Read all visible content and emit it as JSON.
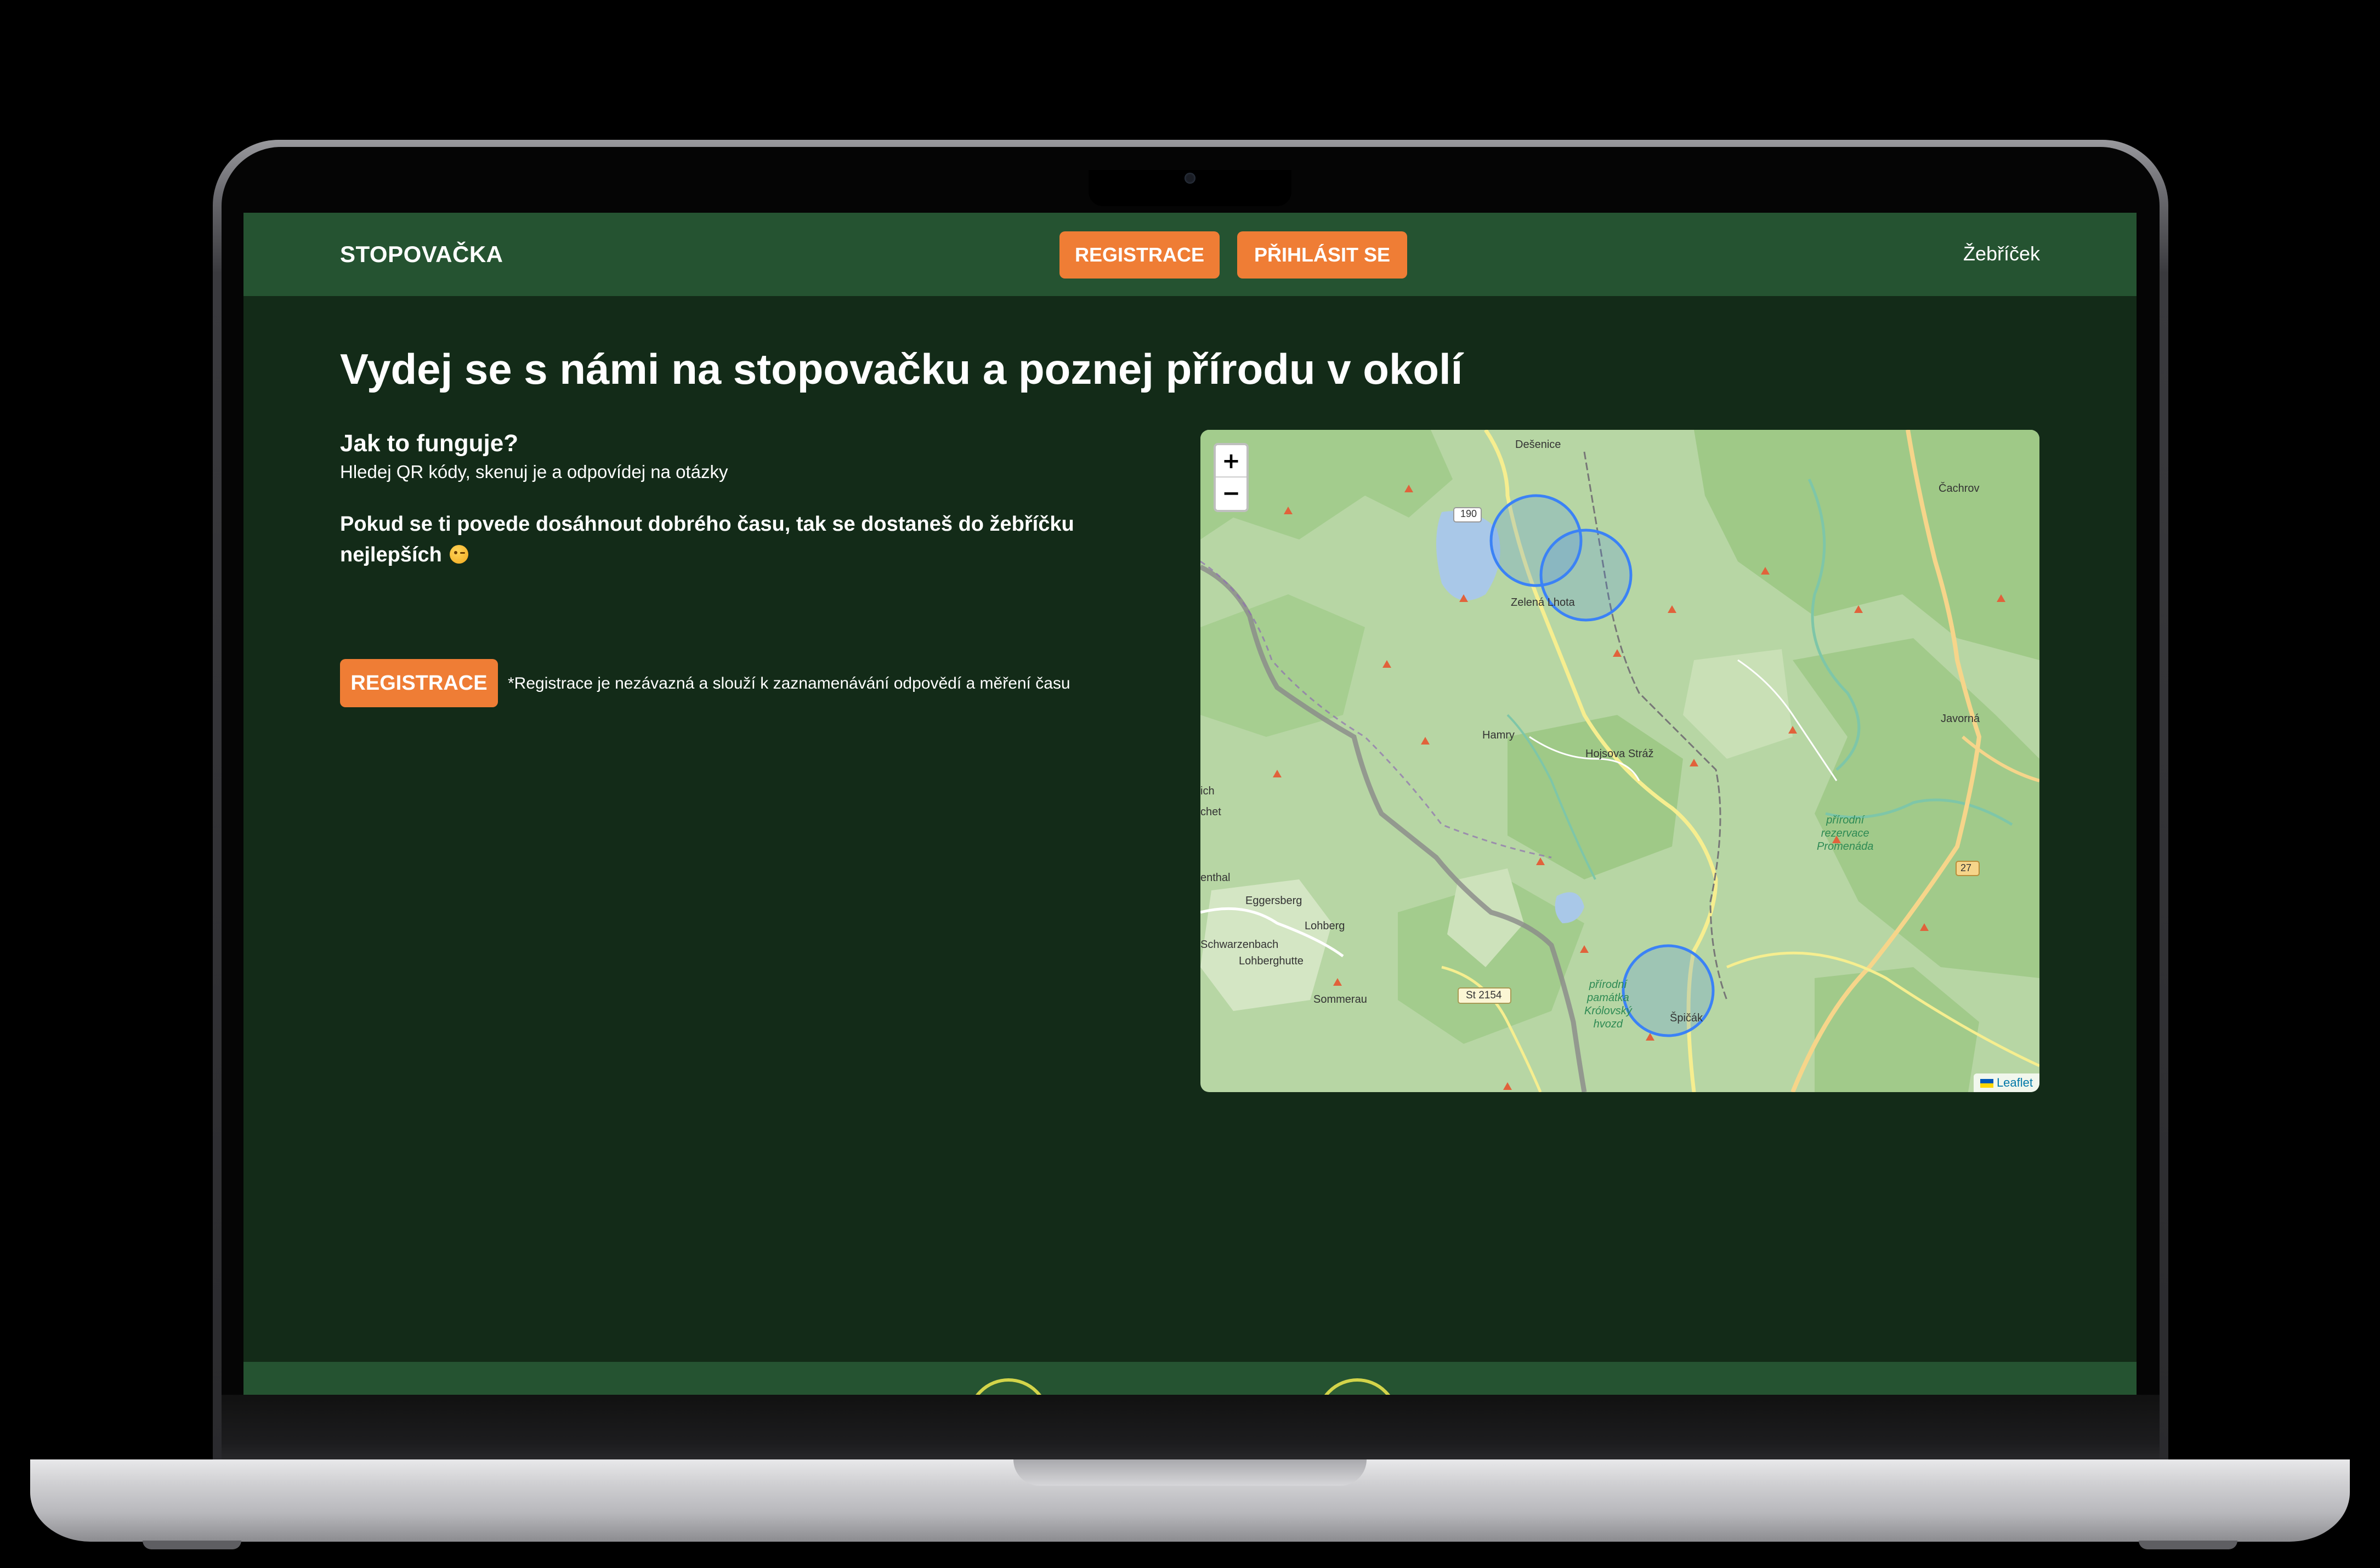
{
  "navbar": {
    "brand": "STOPOVAČKA",
    "register_label": "REGISTRACE",
    "login_label": "PŘIHLÁSIT SE",
    "leaderboard_label": "Žebříček"
  },
  "hero": {
    "title": "Vydej se s námi na stopovačku a poznej přírodu v okolí"
  },
  "how_it_works": {
    "title": "Jak to funguje?",
    "text": "Hledej QR kódy, skenuj je a odpovídej na otázky",
    "info": "Pokud se ti povede dosáhnout dobrého času, tak se dostaneš do žebříčku nejlepších"
  },
  "cta": {
    "register_label": "REGISTRACE",
    "note": "*Registrace je nezávazná a slouží k zaznamenávání odpovědí a měření času"
  },
  "map": {
    "zoom_in": "+",
    "zoom_out": "−",
    "attribution": "Leaflet",
    "labels": {
      "desenice": "Dešenice",
      "cachrov": "Čachrov",
      "road_190": "190",
      "zelena_lhota": "Zelená Lhota",
      "javorna": "Javorná",
      "hamry": "Hamry",
      "hojsova_straz": "Hojsova Stráž",
      "reserve_1": "přírodní\nrezervace\nPromenáda",
      "road_27": "27",
      "ich": "ich",
      "chet": "chet",
      "enthal": "enthal",
      "eggersberg": "Eggersberg",
      "lohberg": "Lohberg",
      "schwarzenbach": "Schwarzenbach",
      "lohberghutte": "Lohberghutte",
      "sommerau": "Sommerau",
      "road_st2154": "St 2154",
      "reserve_2": "přírodní\npamátka\nKrólovský\nhvozd",
      "spicak": "Špičák"
    },
    "icons": [
      "zoom-in-icon",
      "zoom-out-icon",
      "flag-icon"
    ]
  },
  "colors": {
    "page_bg": "#132b18",
    "navbar_bg": "#255331",
    "accent": "#ef7d35",
    "map_bg": "#b7d6a4",
    "marker_circle": "#3b82f6"
  }
}
